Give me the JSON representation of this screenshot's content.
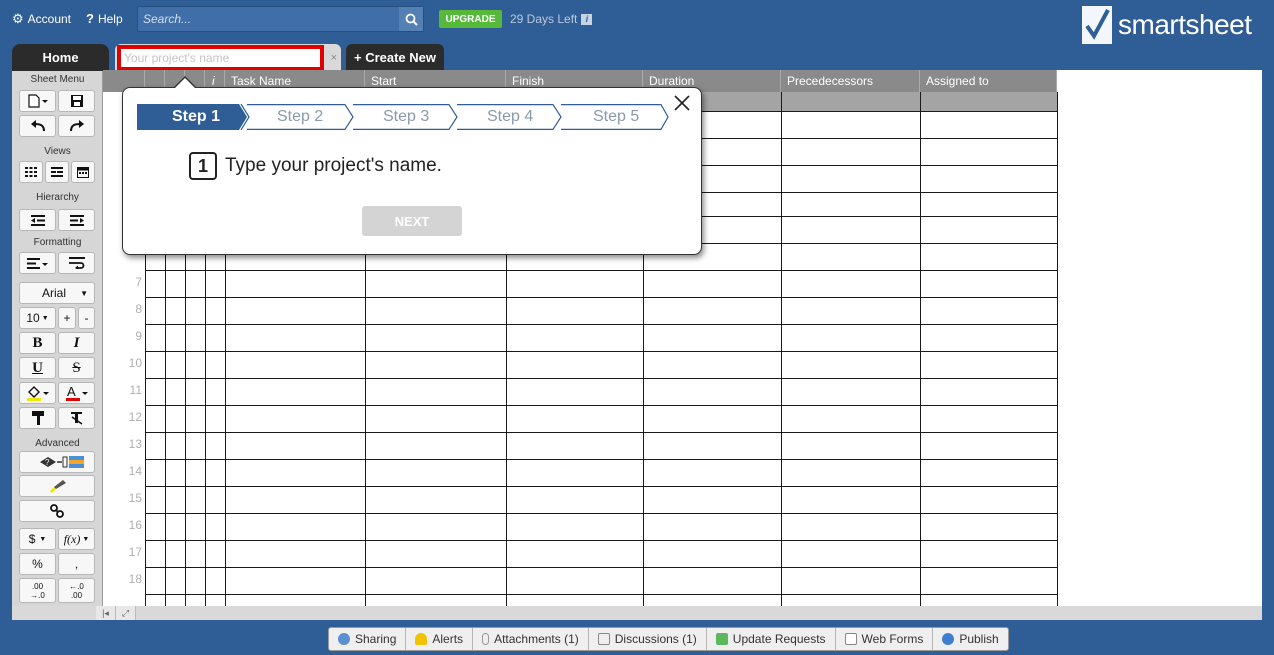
{
  "topbar": {
    "account_label": "Account",
    "help_label": "Help",
    "search_placeholder": "Search...",
    "upgrade_label": "UPGRADE",
    "days_left": "29 Days Left",
    "info_glyph": "i",
    "logo_text": "smartsheet"
  },
  "tabs": {
    "home": "Home",
    "project_placeholder": "Your project's name",
    "close": "×",
    "create_new": "+ Create New"
  },
  "toolbar": {
    "sheet_menu": "Sheet Menu",
    "views": "Views",
    "hierarchy": "Hierarchy",
    "formatting": "Formatting",
    "font_name": "Arial",
    "font_size": "10",
    "plus": "+",
    "minus": "-",
    "bold": "B",
    "italic": "I",
    "underline": "U",
    "strike": "S",
    "advanced": "Advanced",
    "currency": "$",
    "function": "f(x)",
    "percent": "%",
    "comma": ",",
    "decimal_add_top": ".00",
    "decimal_add_bottom": "→.0",
    "decimal_remove_top": "←.0",
    "decimal_remove_bottom": ".00"
  },
  "grid": {
    "columns": [
      "Task Name",
      "Start",
      "Finish",
      "Duration",
      "Precedecessors",
      "Assigned to"
    ],
    "info_col_icon": "i",
    "row_numbers": [
      "7",
      "8",
      "9",
      "10",
      "11",
      "12",
      "13",
      "14",
      "15",
      "16",
      "17",
      "18"
    ]
  },
  "wizard": {
    "steps": [
      "Step 1",
      "Step 2",
      "Step 3",
      "Step 4",
      "Step 5"
    ],
    "active_step": 1,
    "step_number": "1",
    "message": "Type your project's name.",
    "next_label": "NEXT"
  },
  "bottom_tabs": [
    {
      "label": "Sharing",
      "icon": "people-icon"
    },
    {
      "label": "Alerts",
      "icon": "bell-icon"
    },
    {
      "label": "Attachments (1)",
      "icon": "paperclip-icon"
    },
    {
      "label": "Discussions (1)",
      "icon": "speech-bubble-icon"
    },
    {
      "label": "Update Requests",
      "icon": "update-request-icon"
    },
    {
      "label": "Web Forms",
      "icon": "form-icon"
    },
    {
      "label": "Publish",
      "icon": "globe-icon"
    }
  ],
  "colors": {
    "background": "#2f5e96",
    "upgrade": "#56b93a",
    "active_step": "#2f5e96",
    "highlight_border": "#e00000"
  }
}
